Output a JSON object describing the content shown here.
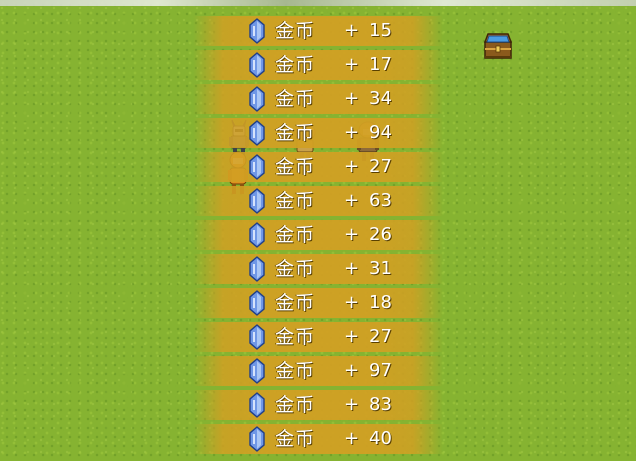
{
  "rewards": [
    {
      "name": "金币",
      "plus": "+",
      "amount": "15",
      "icon": "blue-crystal-icon"
    },
    {
      "name": "金币",
      "plus": "+",
      "amount": "17",
      "icon": "blue-crystal-icon"
    },
    {
      "name": "金币",
      "plus": "+",
      "amount": "34",
      "icon": "blue-crystal-icon"
    },
    {
      "name": "金币",
      "plus": "+",
      "amount": "94",
      "icon": "blue-crystal-icon"
    },
    {
      "name": "金币",
      "plus": "+",
      "amount": "27",
      "icon": "blue-crystal-icon"
    },
    {
      "name": "金币",
      "plus": "+",
      "amount": "63",
      "icon": "blue-crystal-icon"
    },
    {
      "name": "金币",
      "plus": "+",
      "amount": "26",
      "icon": "blue-crystal-icon"
    },
    {
      "name": "金币",
      "plus": "+",
      "amount": "31",
      "icon": "blue-crystal-icon"
    },
    {
      "name": "金币",
      "plus": "+",
      "amount": "18",
      "icon": "blue-crystal-icon"
    },
    {
      "name": "金币",
      "plus": "+",
      "amount": "27",
      "icon": "blue-crystal-icon"
    },
    {
      "name": "金币",
      "plus": "+",
      "amount": "97",
      "icon": "blue-crystal-icon"
    },
    {
      "name": "金币",
      "plus": "+",
      "amount": "83",
      "icon": "blue-crystal-icon"
    },
    {
      "name": "金币",
      "plus": "+",
      "amount": "40",
      "icon": "blue-crystal-icon"
    }
  ],
  "map_objects": {
    "chest_icon": "treasure-chest-icon",
    "characters": [
      "armored-knight-sprite",
      "blonde-hero-sprite",
      "orange-fighter-sprite",
      "helmeted-soldier-sprite"
    ]
  },
  "colors": {
    "grass": "#86b331",
    "reward_band": "#d1a023",
    "crystal": "#6f97e6",
    "text": "#ffffff"
  }
}
